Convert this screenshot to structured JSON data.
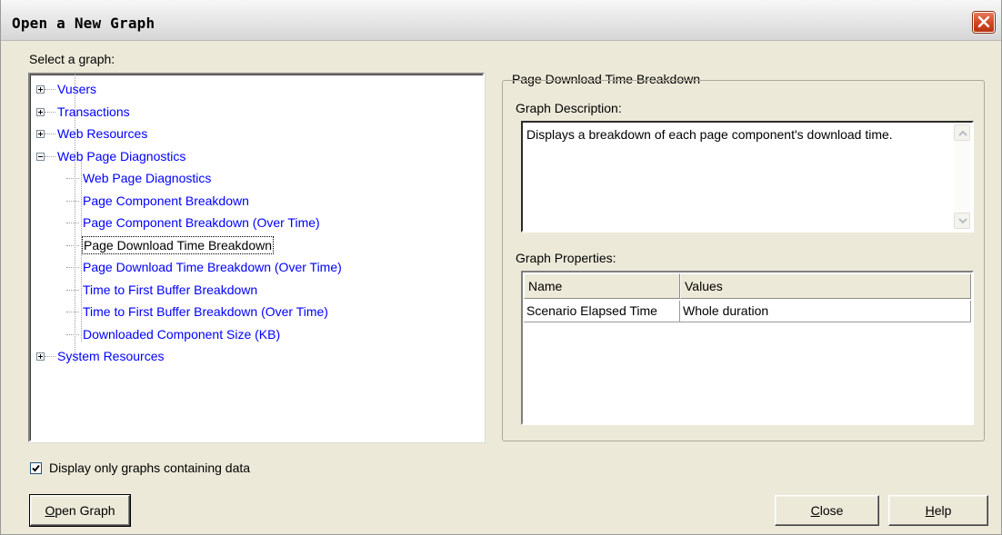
{
  "window": {
    "title": "Open a New Graph",
    "close_icon": "close-x-icon"
  },
  "select_label": "Select a graph:",
  "tree": {
    "nodes": [
      {
        "label": "Vusers",
        "level": 0,
        "expander": "plus"
      },
      {
        "label": "Transactions",
        "level": 0,
        "expander": "plus"
      },
      {
        "label": "Web Resources",
        "level": 0,
        "expander": "plus"
      },
      {
        "label": "Web Page Diagnostics",
        "level": 0,
        "expander": "minus"
      },
      {
        "label": "Web Page Diagnostics",
        "level": 1
      },
      {
        "label": "Page Component Breakdown",
        "level": 1
      },
      {
        "label": "Page Component Breakdown (Over Time)",
        "level": 1
      },
      {
        "label": "Page Download Time Breakdown",
        "level": 1,
        "selected": true
      },
      {
        "label": "Page Download Time Breakdown (Over Time)",
        "level": 1
      },
      {
        "label": "Time to First Buffer Breakdown",
        "level": 1
      },
      {
        "label": "Time to First Buffer Breakdown (Over Time)",
        "level": 1
      },
      {
        "label": "Downloaded Component Size (KB)",
        "level": 1
      },
      {
        "label": "System Resources",
        "level": 0,
        "expander": "plus"
      }
    ]
  },
  "details": {
    "group_title": "Page Download Time Breakdown",
    "description_label": "Graph Description:",
    "description_text": "Displays a breakdown of each page component's download time.",
    "properties_label": "Graph Properties:",
    "columns": [
      "Name",
      "Values"
    ],
    "rows": [
      {
        "name": "Scenario Elapsed Time",
        "value": "Whole duration"
      }
    ]
  },
  "checkbox": {
    "label": "Display only graphs containing data",
    "checked": true
  },
  "buttons": {
    "open_graph": {
      "mnemonic": "O",
      "rest": "pen Graph"
    },
    "close": {
      "mnemonic": "C",
      "rest": "lose"
    },
    "help": {
      "mnemonic": "H",
      "rest": "elp"
    }
  },
  "colors": {
    "link": "#0000ff",
    "dialog_bg": "#ece9d8",
    "close_button": "#d24a24"
  }
}
